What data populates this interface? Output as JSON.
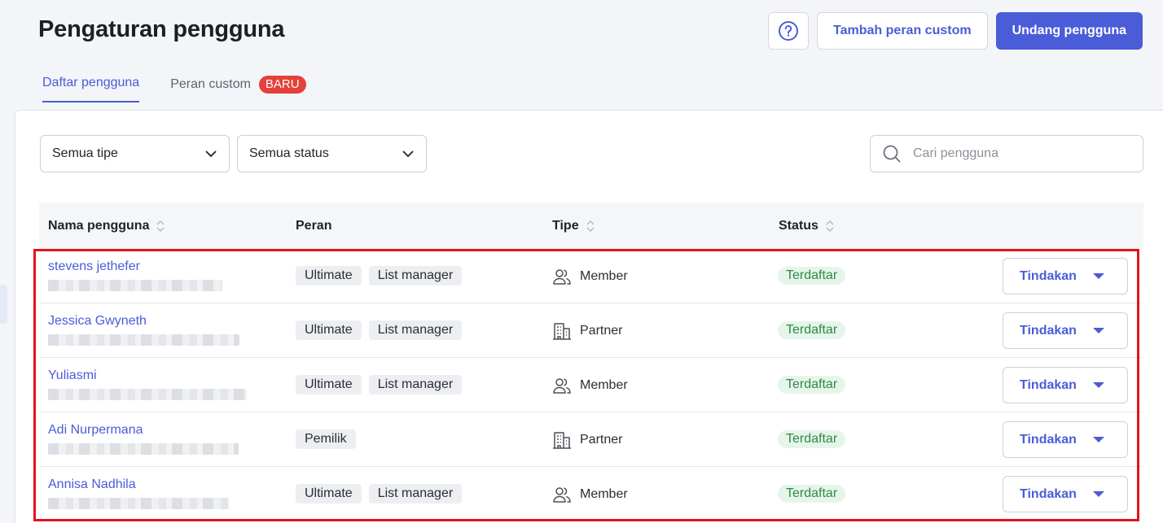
{
  "header": {
    "title": "Pengaturan pengguna",
    "help_icon": "question-circle-icon",
    "add_custom_role_label": "Tambah peran custom",
    "invite_user_label": "Undang pengguna"
  },
  "tabs": [
    {
      "label": "Daftar pengguna",
      "active": true
    },
    {
      "label": "Peran custom",
      "badge": "BARU",
      "active": false
    }
  ],
  "filters": {
    "type_value": "Semua tipe",
    "status_value": "Semua status"
  },
  "search": {
    "placeholder": "Cari pengguna"
  },
  "table": {
    "columns": [
      "Nama pengguna",
      "Peran",
      "Tipe",
      "Status"
    ],
    "rows": [
      {
        "name": "stevens jethefer",
        "roles": [
          "Ultimate",
          "List manager"
        ],
        "type": "Member",
        "type_icon": "users-icon",
        "status": "Terdaftar",
        "action": "Tindakan"
      },
      {
        "name": "Jessica Gwyneth",
        "roles": [
          "Ultimate",
          "List manager"
        ],
        "type": "Partner",
        "type_icon": "building-icon",
        "status": "Terdaftar",
        "action": "Tindakan"
      },
      {
        "name": "Yuliasmi",
        "roles": [
          "Ultimate",
          "List manager"
        ],
        "type": "Member",
        "type_icon": "users-icon",
        "status": "Terdaftar",
        "action": "Tindakan"
      },
      {
        "name": "Adi Nurpermana",
        "roles": [
          "Pemilik"
        ],
        "type": "Partner",
        "type_icon": "building-icon",
        "status": "Terdaftar",
        "action": "Tindakan"
      },
      {
        "name": "Annisa Nadhila",
        "roles": [
          "Ultimate",
          "List manager"
        ],
        "type": "Member",
        "type_icon": "users-icon",
        "status": "Terdaftar",
        "action": "Tindakan"
      }
    ]
  },
  "colors": {
    "accent": "#4a5cd8",
    "badge_red": "#e5403a",
    "status_green": "#2e8a45",
    "highlight_red": "#e2141c"
  }
}
